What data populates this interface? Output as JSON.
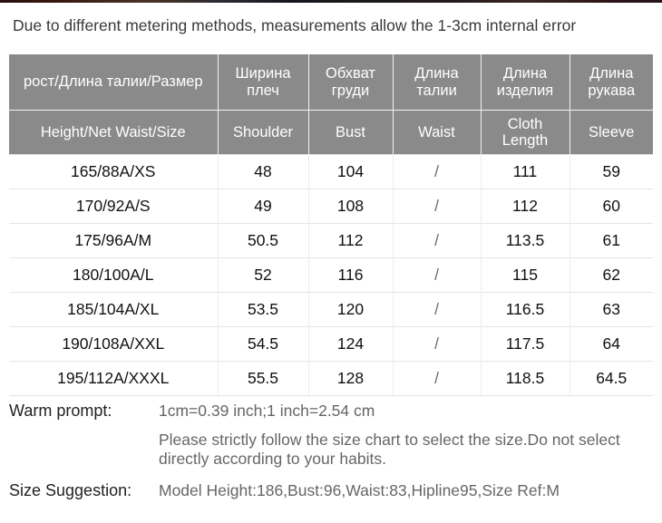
{
  "notice": "Due to different metering methods, measurements allow the 1-3cm internal error",
  "table": {
    "headers_ru": [
      "рост/Длина талии/Размер",
      "Ширина плеч",
      "Обхват груди",
      "Длина талии",
      "Длина изделия",
      "Длина рукава"
    ],
    "headers_en": [
      "Height/Net  Waist/Size",
      "Shoulder",
      "Bust",
      "Waist",
      "Cloth Length",
      "Sleeve"
    ],
    "rows": [
      [
        "165/88A/XS",
        "48",
        "104",
        "/",
        "111",
        "59"
      ],
      [
        "170/92A/S",
        "49",
        "108",
        "/",
        "112",
        "60"
      ],
      [
        "175/96A/M",
        "50.5",
        "112",
        "/",
        "113.5",
        "61"
      ],
      [
        "180/100A/L",
        "52",
        "116",
        "/",
        "115",
        "62"
      ],
      [
        "185/104A/XL",
        "53.5",
        "120",
        "/",
        "116.5",
        "63"
      ],
      [
        "190/108A/XXL",
        "54.5",
        "124",
        "/",
        "117.5",
        "64"
      ],
      [
        "195/112A/XXXL",
        "55.5",
        "128",
        "/",
        "118.5",
        "64.5"
      ]
    ]
  },
  "footer": {
    "warm_prompt_label": "Warm prompt:",
    "conversion": "1cm=0.39 inch;1 inch=2.54 cm",
    "instruction": "Please strictly follow the size chart  to select the size.Do not select directly according to your habits.",
    "size_suggestion_label": "Size Suggestion:",
    "size_suggestion_value": "Model Height:186,Bust:96,Waist:83,Hipline95,Size Ref:M"
  },
  "colors": {
    "header_bg": "#8a8a8a",
    "header_text": "#ffffff",
    "body_text": "#111111",
    "muted_text": "#666666"
  }
}
